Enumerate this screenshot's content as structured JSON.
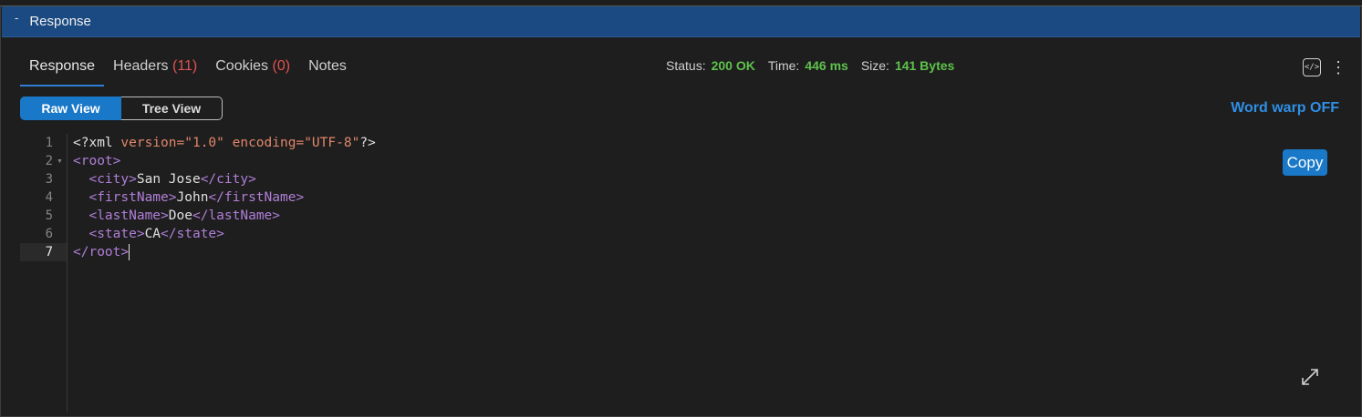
{
  "panel": {
    "title": "Response",
    "collapse_glyph": "-"
  },
  "tabs": [
    {
      "label": "Response",
      "count": ""
    },
    {
      "label": "Headers",
      "count": "(11)"
    },
    {
      "label": "Cookies",
      "count": "(0)"
    },
    {
      "label": "Notes",
      "count": ""
    }
  ],
  "stats": {
    "status_label": "Status:",
    "status_value": "200 OK",
    "time_label": "Time:",
    "time_value": "446 ms",
    "size_label": "Size:",
    "size_value": "141 Bytes"
  },
  "views": {
    "raw": "Raw View",
    "tree": "Tree View"
  },
  "word_wrap": "Word warp OFF",
  "copy_label": "Copy",
  "icons": {
    "code": "code-view-icon",
    "more": "more-vertical-icon",
    "expand": "expand-icon"
  },
  "editor": {
    "line_numbers": [
      "1",
      "2",
      "3",
      "4",
      "5",
      "6",
      "7"
    ],
    "lines": [
      {
        "p1": "<?xml ",
        "a1": "version=",
        "s1": "\"1.0\"",
        "a2": " encoding=",
        "s2": "\"UTF-8\"",
        "p2": "?>"
      },
      {
        "open": "<root>"
      },
      {
        "indent": "  ",
        "open": "<city>",
        "text": "San Jose",
        "close": "</city>"
      },
      {
        "indent": "  ",
        "open": "<firstName>",
        "text": "John",
        "close": "</firstName>"
      },
      {
        "indent": "  ",
        "open": "<lastName>",
        "text": "Doe",
        "close": "</lastName>"
      },
      {
        "indent": "  ",
        "open": "<state>",
        "text": "CA",
        "close": "</state>"
      },
      {
        "close": "</root>"
      }
    ]
  },
  "colors": {
    "accent": "#1a78c8",
    "header_bg": "#1b4a82",
    "success": "#5ec24b",
    "count": "#e05252"
  }
}
